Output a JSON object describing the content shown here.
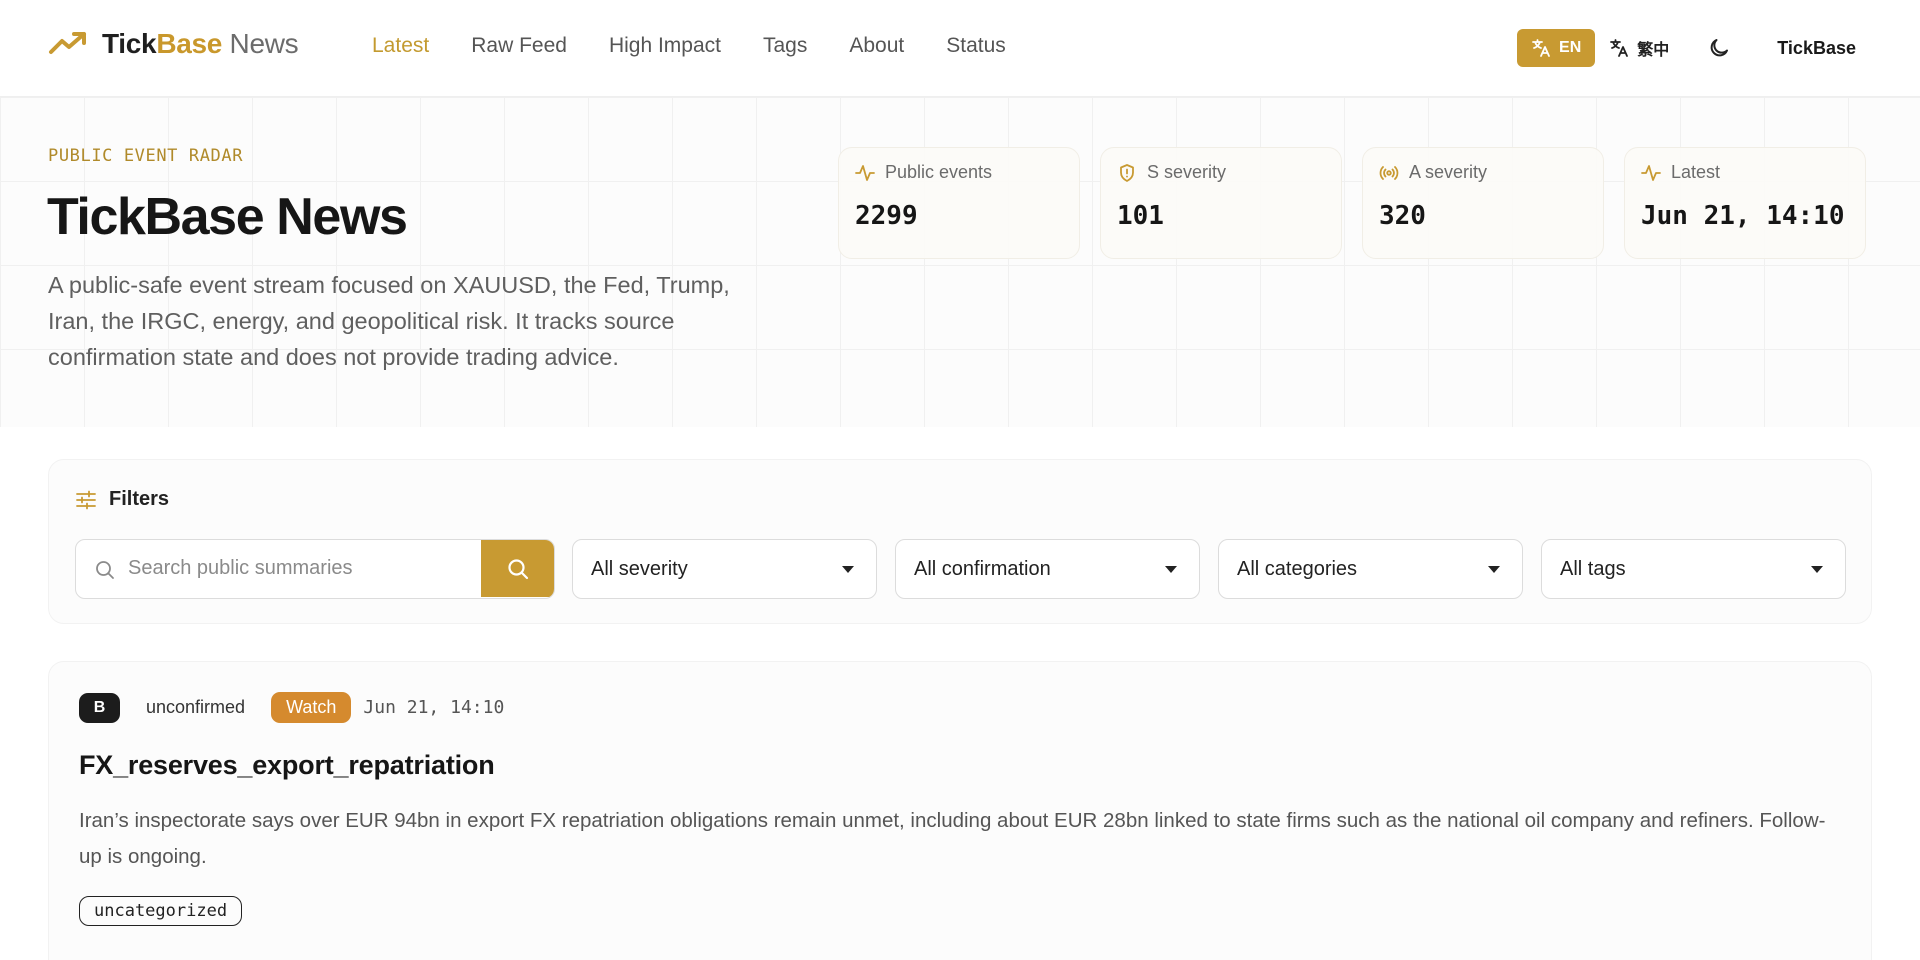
{
  "header": {
    "brand_part1": "Tick",
    "brand_part2": "Base",
    "brand_part3": " News",
    "logo_icon": "trending-up-icon",
    "nav": [
      "Latest",
      "Raw Feed",
      "High Impact",
      "Tags",
      "About",
      "Status"
    ],
    "active_nav": "Latest",
    "lang_en": "EN",
    "lang_zh": "繁中",
    "theme_icon": "moon-icon",
    "user": "TickBase"
  },
  "hero": {
    "eyebrow": "PUBLIC EVENT RADAR",
    "title": "TickBase News",
    "description": "A public-safe event stream focused on XAUUSD, the Fed, Trump, Iran, the IRGC, energy, and geopolitical risk. It tracks source confirmation state and does not provide trading advice.",
    "stats": [
      {
        "label": "Public events",
        "value": "2299",
        "icon": "activity-icon"
      },
      {
        "label": "S severity",
        "value": "101",
        "icon": "shield-alert-icon"
      },
      {
        "label": "A severity",
        "value": "320",
        "icon": "radio-icon"
      },
      {
        "label": "Latest",
        "value": "Jun 21, 14:10",
        "icon": "activity-icon"
      }
    ]
  },
  "filters": {
    "title": "Filters",
    "search_placeholder": "Search public summaries",
    "search_value": "",
    "severity": "All severity",
    "confirmation": "All confirmation",
    "categories": "All categories",
    "tags": "All tags"
  },
  "events": [
    {
      "severity": "B",
      "confirmation": "unconfirmed",
      "impact": "Watch",
      "time": "Jun 21, 14:10",
      "title": "FX_reserves_export_repatriation",
      "summary": "Iran’s inspectorate says over EUR 94bn in export FX repatriation obligations remain unmet, including about EUR 28bn linked to state firms such as the national oil company and refiners. Follow-up is ongoing.",
      "tags": [
        "uncategorized"
      ]
    }
  ],
  "colors": {
    "accent": "#c89a32",
    "watch": "#d58a2e",
    "text": "#161616",
    "muted": "#5f5f5f"
  }
}
